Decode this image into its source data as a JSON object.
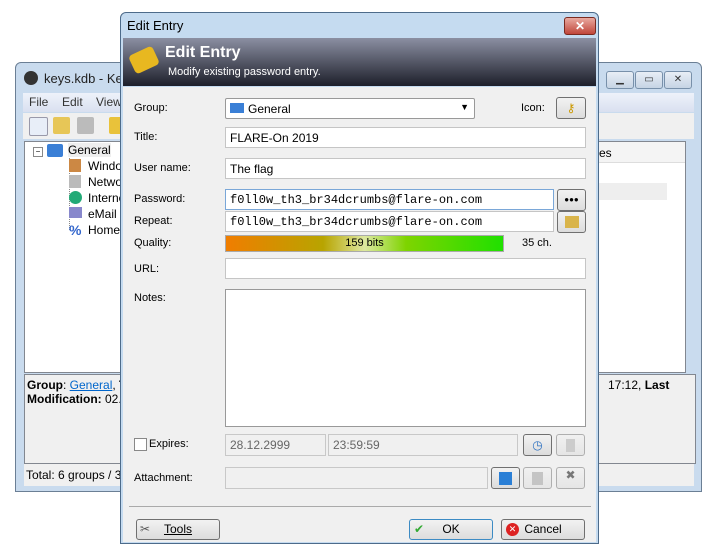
{
  "main_window": {
    "title": "keys.kdb - KeePass",
    "menu": [
      "File",
      "Edit",
      "View"
    ],
    "tree": {
      "root": "General",
      "children": [
        "Windows",
        "Network",
        "Internet",
        "eMail",
        "Homebanking"
      ]
    },
    "list_header_partial": "es",
    "info": {
      "group_label": "Group",
      "group_value": "General",
      "title_label": "Ti",
      "right_text": "17:12, ",
      "last_label": "Last",
      "mod_label": "Modification:",
      "mod_value": "02.0"
    },
    "status": "Total: 6 groups / 3"
  },
  "dialog": {
    "title": "Edit Entry",
    "banner_title": "Edit Entry",
    "banner_subtitle": "Modify existing password entry.",
    "group_label": "Group:",
    "group_value": "General",
    "icon_label": "Icon:",
    "title_label": "Title:",
    "title_value": "FLARE-On 2019",
    "username_label": "User name:",
    "username_value": "The flag",
    "password_label": "Password:",
    "password_value": "f0ll0w_th3_br34dcrumbs@flare-on.com",
    "repeat_label": "Repeat:",
    "repeat_value": "f0ll0w_th3_br34dcrumbs@flare-on.com",
    "quality_label": "Quality:",
    "quality_text": "159 bits",
    "quality_fraction": 0.99,
    "length_text": "35 ch.",
    "url_label": "URL:",
    "url_value": "",
    "notes_label": "Notes:",
    "notes_value": "",
    "expires_label": "Expires:",
    "expires_checked": false,
    "expires_date": "28.12.2999",
    "expires_time": "23:59:59",
    "attachment_label": "Attachment:",
    "attachment_value": "",
    "tools_label": "Tools",
    "ok_label": "OK",
    "cancel_label": "Cancel",
    "show_password_label": "●●●"
  }
}
